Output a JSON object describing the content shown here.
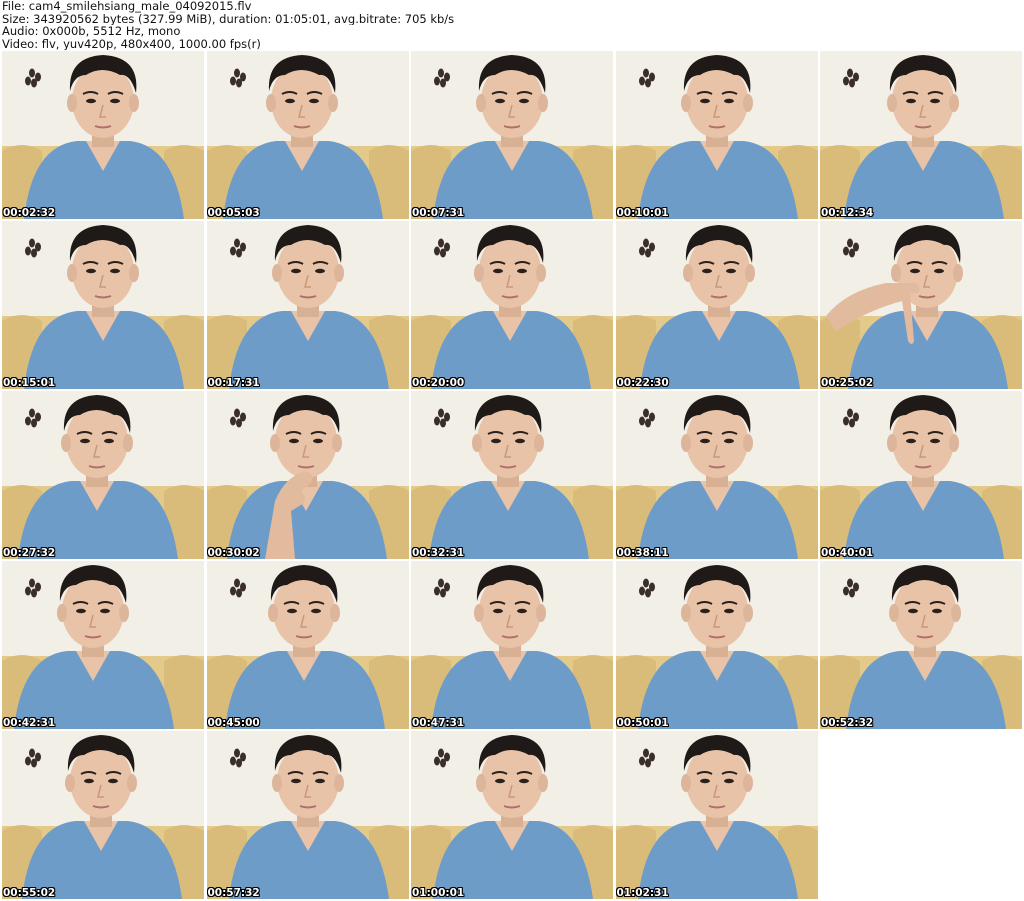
{
  "header": {
    "file_line": "File: cam4_smilehsiang_male_04092015.flv",
    "size_line": "Size: 343920562 bytes (327.99 MiB), duration: 01:05:01, avg.bitrate: 705 kb/s",
    "audio_line": "Audio: 0x000b, 5512 Hz, mono",
    "video_line": "Video: flv, yuv420p, 480x400, 1000.00 fps(r)"
  },
  "thumbnails": [
    {
      "timestamp": "00:02:32",
      "subject": "person-wearing-blue-shirt"
    },
    {
      "timestamp": "00:05:03",
      "subject": "person-wearing-blue-shirt"
    },
    {
      "timestamp": "00:07:31",
      "subject": "person-wearing-blue-shirt"
    },
    {
      "timestamp": "00:10:01",
      "subject": "person-wearing-blue-shirt"
    },
    {
      "timestamp": "00:12:34",
      "subject": "person-wearing-blue-shirt"
    },
    {
      "timestamp": "00:15:01",
      "subject": "person-wearing-blue-shirt"
    },
    {
      "timestamp": "00:17:31",
      "subject": "person-wearing-blue-shirt"
    },
    {
      "timestamp": "00:20:00",
      "subject": "person-wearing-blue-shirt"
    },
    {
      "timestamp": "00:22:30",
      "subject": "person-wearing-blue-shirt"
    },
    {
      "timestamp": "00:25:02",
      "subject": "person-pointing-hand"
    },
    {
      "timestamp": "00:27:32",
      "subject": "person-wearing-blue-shirt"
    },
    {
      "timestamp": "00:30:02",
      "subject": "person-hand-on-chin"
    },
    {
      "timestamp": "00:32:31",
      "subject": "person-wearing-blue-shirt"
    },
    {
      "timestamp": "00:38:11",
      "subject": "person-wearing-blue-shirt"
    },
    {
      "timestamp": "00:40:01",
      "subject": "person-wearing-blue-shirt"
    },
    {
      "timestamp": "00:42:31",
      "subject": "person-wearing-blue-shirt"
    },
    {
      "timestamp": "00:45:00",
      "subject": "person-wearing-blue-shirt"
    },
    {
      "timestamp": "00:47:31",
      "subject": "person-wearing-blue-shirt"
    },
    {
      "timestamp": "00:50:01",
      "subject": "person-wearing-blue-shirt"
    },
    {
      "timestamp": "00:52:32",
      "subject": "person-wearing-blue-shirt"
    },
    {
      "timestamp": "00:55:02",
      "subject": "person-wearing-blue-shirt"
    },
    {
      "timestamp": "00:57:32",
      "subject": "person-wearing-blue-shirt"
    },
    {
      "timestamp": "01:00:01",
      "subject": "person-wearing-blue-shirt"
    },
    {
      "timestamp": "01:02:31",
      "subject": "person-wearing-blue-shirt"
    }
  ],
  "colors": {
    "page_background": "#ffffff",
    "wall": "#f1efe6",
    "sofa": "#e3c98a",
    "shirt": "#6d9cc9",
    "skin": "#e8c3a8",
    "hair": "#1f1a17",
    "timestamp_text": "#ffffff"
  }
}
